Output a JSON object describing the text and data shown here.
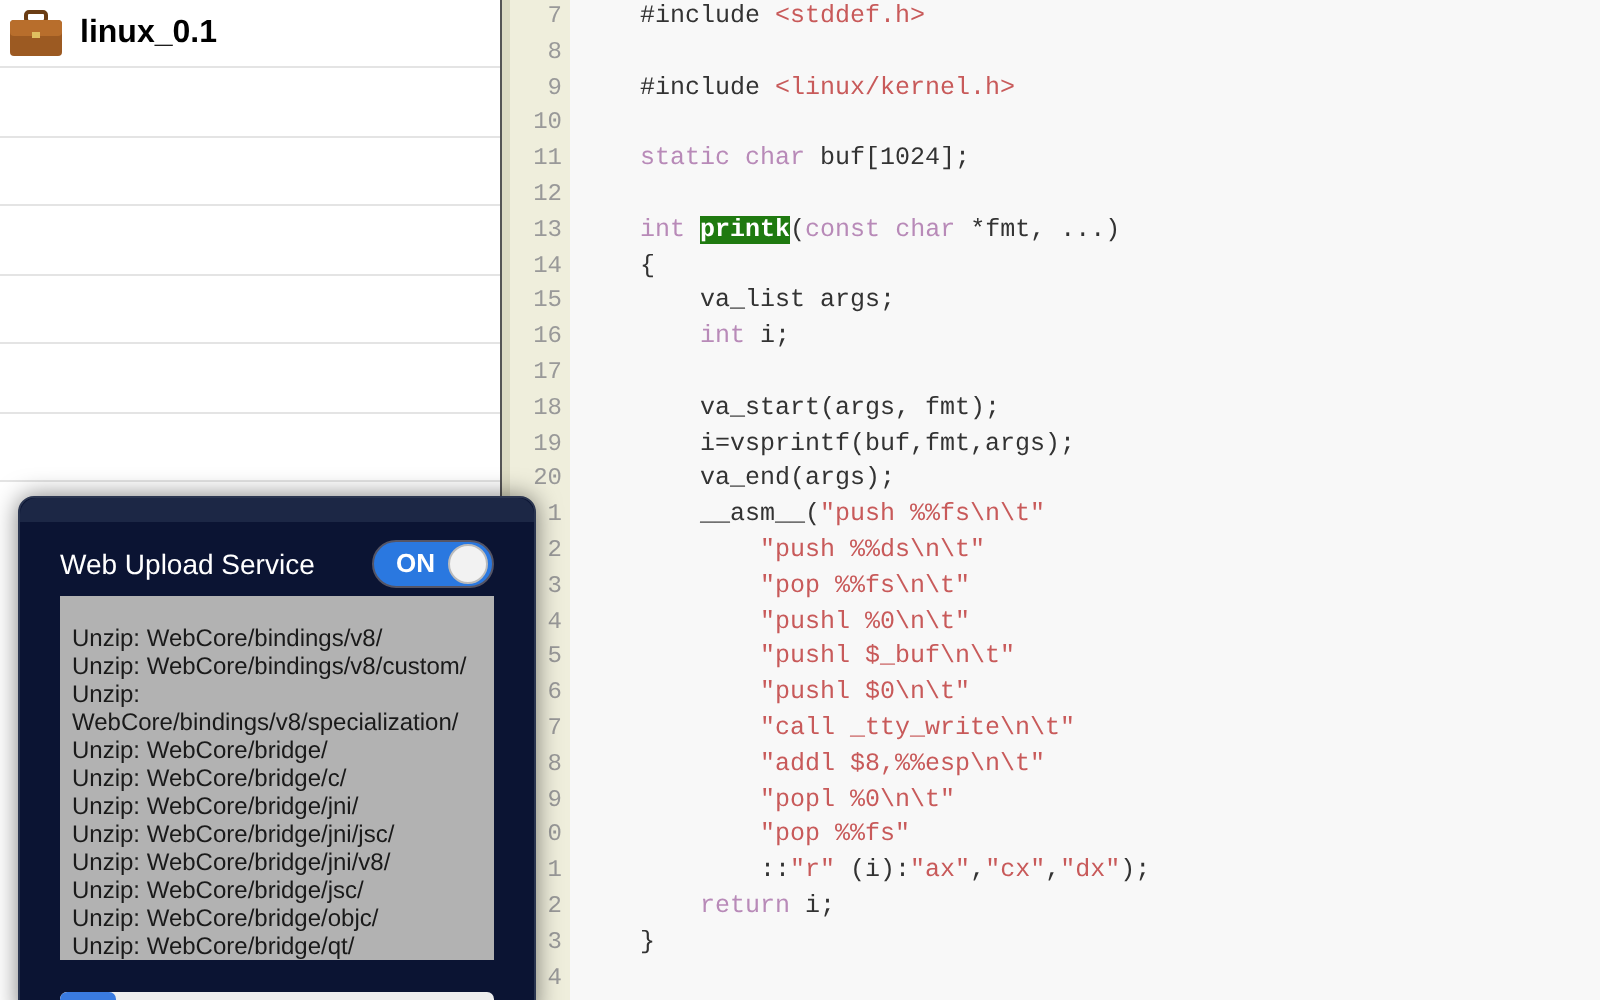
{
  "project_list": {
    "items": [
      {
        "name": "linux_0.1"
      }
    ]
  },
  "editor": {
    "lines": [
      {
        "number": "7",
        "tokens": [
          {
            "kind": "plain",
            "text": "#include "
          },
          {
            "kind": "string",
            "text": "<stddef.h>"
          }
        ]
      },
      {
        "number": "8"
      },
      {
        "number": "9",
        "tokens": [
          {
            "kind": "plain",
            "text": "#include "
          },
          {
            "kind": "string",
            "text": "<linux/kernel.h>"
          }
        ]
      },
      {
        "number": "10"
      },
      {
        "number": "11",
        "tokens": [
          {
            "kind": "keyword",
            "text": "static"
          },
          {
            "kind": "keyword",
            "text": " char"
          },
          {
            "kind": "plain",
            "text": " buf[1024];"
          }
        ]
      },
      {
        "number": "12"
      },
      {
        "number": "13",
        "tokens": [
          {
            "kind": "keyword",
            "text": "int "
          },
          {
            "kind": "match",
            "text": "printk"
          },
          {
            "kind": "plain",
            "text": "("
          },
          {
            "kind": "keyword",
            "text": "const"
          },
          {
            "kind": "keyword",
            "text": " char"
          },
          {
            "kind": "plain",
            "text": " *fmt, ...)"
          }
        ]
      },
      {
        "number": "14",
        "tokens": [
          {
            "kind": "plain",
            "text": "{"
          }
        ]
      },
      {
        "number": "15",
        "tokens": [
          {
            "kind": "plain",
            "text": "    va_list args;"
          }
        ]
      },
      {
        "number": "16",
        "tokens": [
          {
            "kind": "keyword",
            "text": "    int"
          },
          {
            "kind": "plain",
            "text": " i;"
          }
        ]
      },
      {
        "number": "17"
      },
      {
        "number": "18",
        "tokens": [
          {
            "kind": "plain",
            "text": "    va_start(args, fmt);"
          }
        ]
      },
      {
        "number": "19",
        "tokens": [
          {
            "kind": "plain",
            "text": "    i=vsprintf(buf,fmt,args);"
          }
        ]
      },
      {
        "number": "20",
        "tokens": [
          {
            "kind": "plain",
            "text": "    va_end(args);"
          }
        ]
      },
      {
        "number": "1",
        "tokens": [
          {
            "kind": "plain",
            "text": "    __asm__("
          },
          {
            "kind": "string",
            "text": "\"push %%fs\\n\\t\""
          }
        ]
      },
      {
        "number": "2",
        "tokens": [
          {
            "kind": "string",
            "text": "        \"push %%ds\\n\\t\""
          }
        ]
      },
      {
        "number": "3",
        "tokens": [
          {
            "kind": "string",
            "text": "        \"pop %%fs\\n\\t\""
          }
        ]
      },
      {
        "number": "4",
        "tokens": [
          {
            "kind": "string",
            "text": "        \"pushl %0\\n\\t\""
          }
        ]
      },
      {
        "number": "5",
        "tokens": [
          {
            "kind": "string",
            "text": "        \"pushl $_buf\\n\\t\""
          }
        ]
      },
      {
        "number": "6",
        "tokens": [
          {
            "kind": "string",
            "text": "        \"pushl $0\\n\\t\""
          }
        ]
      },
      {
        "number": "7",
        "tokens": [
          {
            "kind": "string",
            "text": "        \"call _tty_write\\n\\t\""
          }
        ]
      },
      {
        "number": "8",
        "tokens": [
          {
            "kind": "string",
            "text": "        \"addl $8,%%esp\\n\\t\""
          }
        ]
      },
      {
        "number": "9",
        "tokens": [
          {
            "kind": "string",
            "text": "        \"popl %0\\n\\t\""
          }
        ]
      },
      {
        "number": "0",
        "tokens": [
          {
            "kind": "string",
            "text": "        \"pop %%fs\""
          }
        ]
      },
      {
        "number": "1",
        "tokens": [
          {
            "kind": "plain",
            "text": "        ::"
          },
          {
            "kind": "string",
            "text": "\"r\""
          },
          {
            "kind": "plain",
            "text": " (i):"
          },
          {
            "kind": "string",
            "text": "\"ax\""
          },
          {
            "kind": "plain",
            "text": ","
          },
          {
            "kind": "string",
            "text": "\"cx\""
          },
          {
            "kind": "plain",
            "text": ","
          },
          {
            "kind": "string",
            "text": "\"dx\""
          },
          {
            "kind": "plain",
            "text": ");"
          }
        ]
      },
      {
        "number": "2",
        "tokens": [
          {
            "kind": "keyword",
            "text": "    return"
          },
          {
            "kind": "plain",
            "text": " i;"
          }
        ]
      },
      {
        "number": "3",
        "tokens": [
          {
            "kind": "plain",
            "text": "}"
          }
        ]
      },
      {
        "number": "4"
      }
    ]
  },
  "upload_panel": {
    "title": "Web Upload Service",
    "toggle": {
      "on": true,
      "label": "ON"
    },
    "log": [
      "Unzip: WebCore/bindings/v8/",
      "Unzip: WebCore/bindings/v8/custom/",
      "Unzip: WebCore/bindings/v8/specialization/",
      "Unzip: WebCore/bridge/",
      "Unzip: WebCore/bridge/c/",
      "Unzip: WebCore/bridge/jni/",
      "Unzip: WebCore/bridge/jni/jsc/",
      "Unzip: WebCore/bridge/jni/v8/",
      "Unzip: WebCore/bridge/jsc/",
      "Unzip: WebCore/bridge/objc/",
      "Unzip: WebCore/bridge/qt/"
    ],
    "progress": {
      "level": 0.13
    }
  }
}
